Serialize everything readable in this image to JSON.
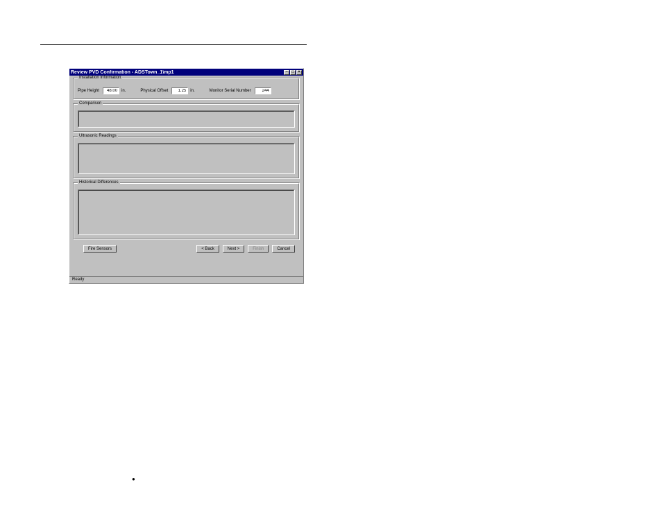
{
  "dialog": {
    "title": "Review PVD Confirmation - ADSTown_1\\mp1",
    "sections": {
      "install_info": {
        "label": "Installation Information",
        "pipe_height_label": "Pipe Height",
        "pipe_height_value": "48.00",
        "pipe_height_unit": "in.",
        "physical_offset_label": "Physical Offset",
        "physical_offset_value": "1.25",
        "physical_offset_unit": "in.",
        "serial_label": "Monitor Serial Number",
        "serial_value": "244"
      },
      "comparison": {
        "label": "Comparison"
      },
      "readings": {
        "label": "Ultrasonic Readings"
      },
      "historical": {
        "label": "Historical Differences"
      }
    },
    "buttons": {
      "fire_sensors": "Fire Sensors",
      "back": "< Back",
      "next": "Next >",
      "finish": "Finish",
      "cancel": "Cancel"
    },
    "status": "Ready"
  },
  "bullet": "●"
}
